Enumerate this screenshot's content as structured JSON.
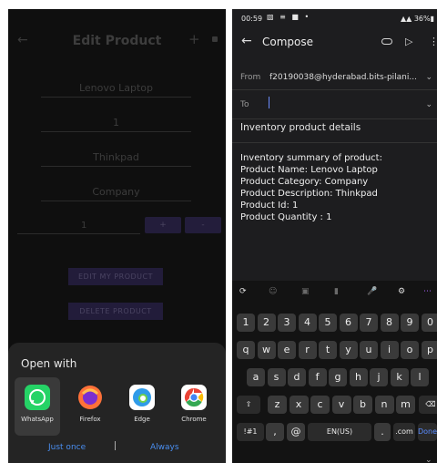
{
  "left": {
    "app_bar": {
      "title": "Edit Product",
      "back_icon": "back-arrow-icon",
      "add_icon": "plus-icon",
      "menu_icon": "more-icon"
    },
    "fields": {
      "name": "Lenovo Laptop",
      "id": "1",
      "description": "Thinkpad",
      "category": "Company",
      "quantity": "1"
    },
    "stepper": {
      "plus": "+",
      "minus": "-"
    },
    "buttons": {
      "edit": "EDIT MY PRODUCT",
      "delete": "DELETE PRODUCT"
    },
    "sheet": {
      "title": "Open with",
      "apps": [
        {
          "label": "WhatsApp",
          "icon": "whatsapp-icon",
          "color": "#25D366"
        },
        {
          "label": "Firefox",
          "icon": "firefox-icon",
          "color": "#FF7139"
        },
        {
          "label": "Edge",
          "icon": "edge-icon",
          "color": "#2f9be8"
        },
        {
          "label": "Chrome",
          "icon": "chrome-icon",
          "color": "#ea4335"
        }
      ],
      "just_once": "Just once",
      "always": "Always"
    }
  },
  "right": {
    "status": {
      "time": "00:59",
      "battery": "36%"
    },
    "app_bar": {
      "title": "Compose"
    },
    "from_label": "From",
    "from_value": "f20190038@hyderabad.bits-pilani...",
    "to_label": "To",
    "subject": "Inventory product details",
    "body": "Inventory summary of product:\nProduct Name: Lenovo Laptop\nProduct Category: Company\nProduct Description: Thinkpad\nProduct Id: 1\nProduct Quantity : 1",
    "keyboard": {
      "row1": [
        "1",
        "2",
        "3",
        "4",
        "5",
        "6",
        "7",
        "8",
        "9",
        "0"
      ],
      "row2": [
        "q",
        "w",
        "e",
        "r",
        "t",
        "y",
        "u",
        "i",
        "o",
        "p"
      ],
      "row3": [
        "a",
        "s",
        "d",
        "f",
        "g",
        "h",
        "j",
        "k",
        "l"
      ],
      "row4": [
        "z",
        "x",
        "c",
        "v",
        "b",
        "n",
        "m"
      ],
      "sym": "!#1",
      "comma": ",",
      "at": "@",
      "space": "EN(US)",
      "period": ".",
      "dotcom": ".com",
      "done": "Done"
    }
  }
}
